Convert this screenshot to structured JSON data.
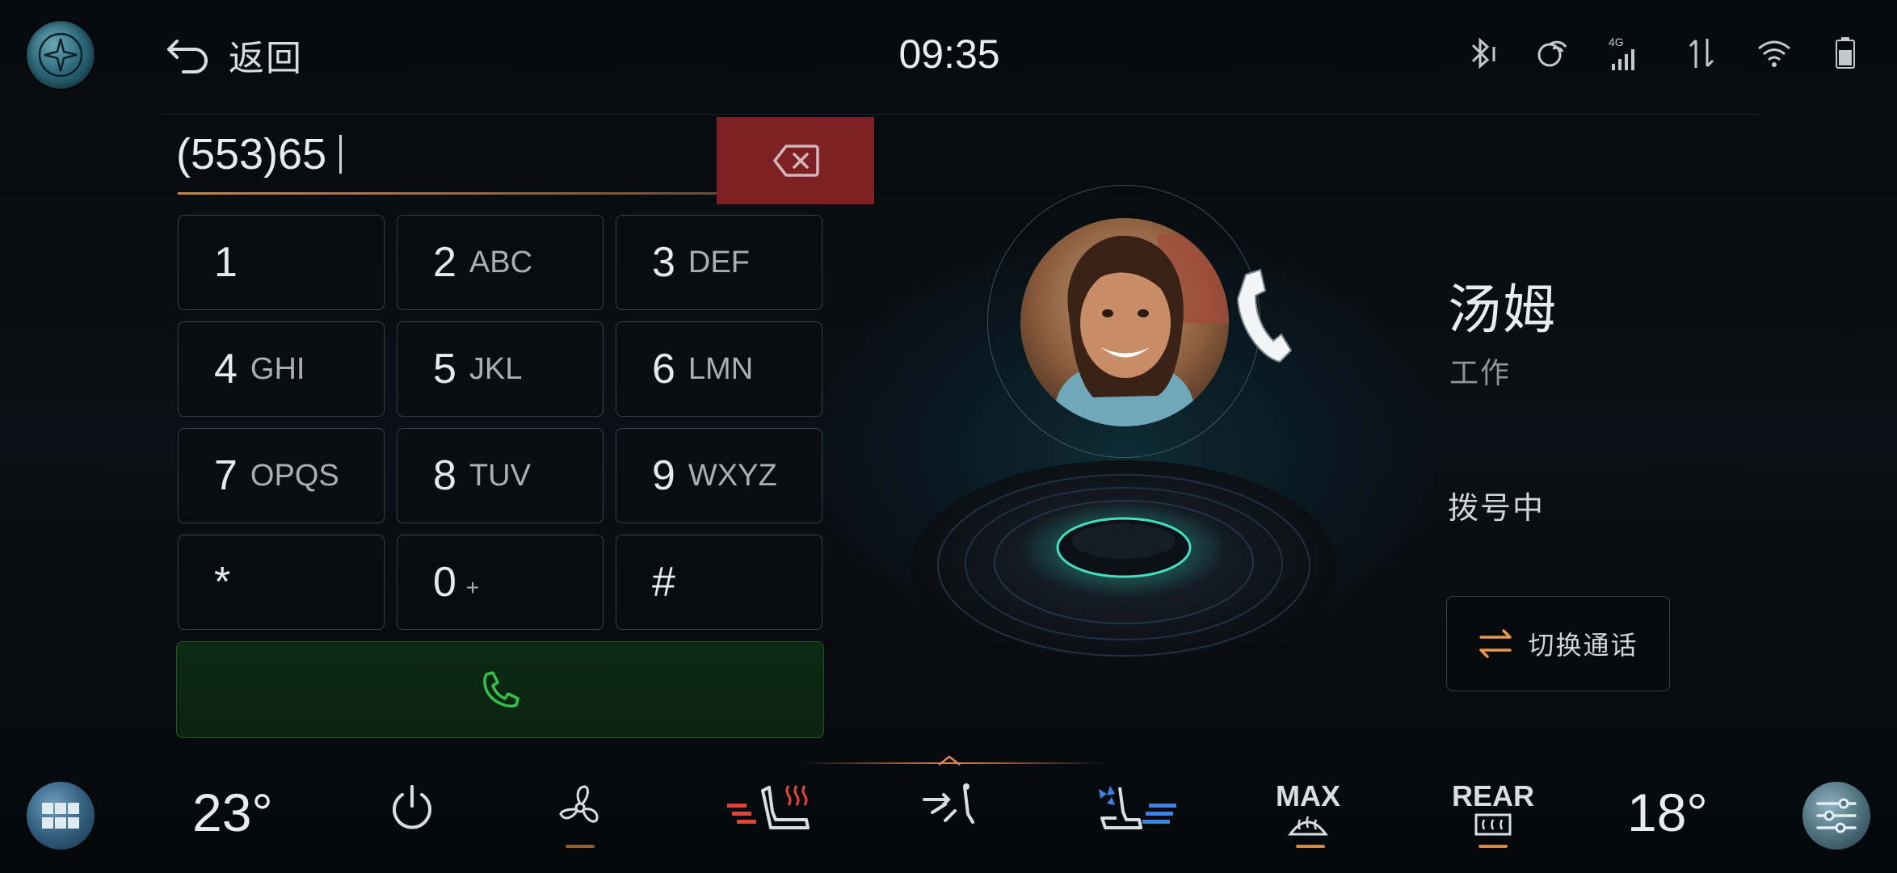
{
  "header": {
    "back_label": "返回",
    "time": "09:35",
    "status_icons": [
      "bluetooth-icon",
      "voice-assistant-icon",
      "cellular-4g-icon",
      "data-transfer-icon",
      "wifi-icon",
      "battery-icon"
    ],
    "network_label": "4G"
  },
  "dialer": {
    "number": "(553)65",
    "keys": [
      {
        "digit": "1",
        "letters": ""
      },
      {
        "digit": "2",
        "letters": "ABC"
      },
      {
        "digit": "3",
        "letters": "DEF"
      },
      {
        "digit": "4",
        "letters": "GHI"
      },
      {
        "digit": "5",
        "letters": "JKL"
      },
      {
        "digit": "6",
        "letters": "LMN"
      },
      {
        "digit": "7",
        "letters": "OPQS"
      },
      {
        "digit": "8",
        "letters": "TUV"
      },
      {
        "digit": "9",
        "letters": "WXYZ"
      },
      {
        "digit": "*",
        "letters": ""
      },
      {
        "digit": "0",
        "letters": "+"
      },
      {
        "digit": "#",
        "letters": ""
      }
    ]
  },
  "contact": {
    "name": "汤姆",
    "type": "工作",
    "status": "拨号中",
    "switch_label": "切换通话"
  },
  "climate": {
    "left_temp": "23°",
    "right_temp": "18°",
    "max_label": "MAX",
    "rear_label": "REAR"
  },
  "colors": {
    "accent": "#d08a47",
    "delete": "#8a2327",
    "call_green": "#2fae44",
    "heat_red": "#e0453a",
    "cool_blue": "#3f7fe0"
  }
}
